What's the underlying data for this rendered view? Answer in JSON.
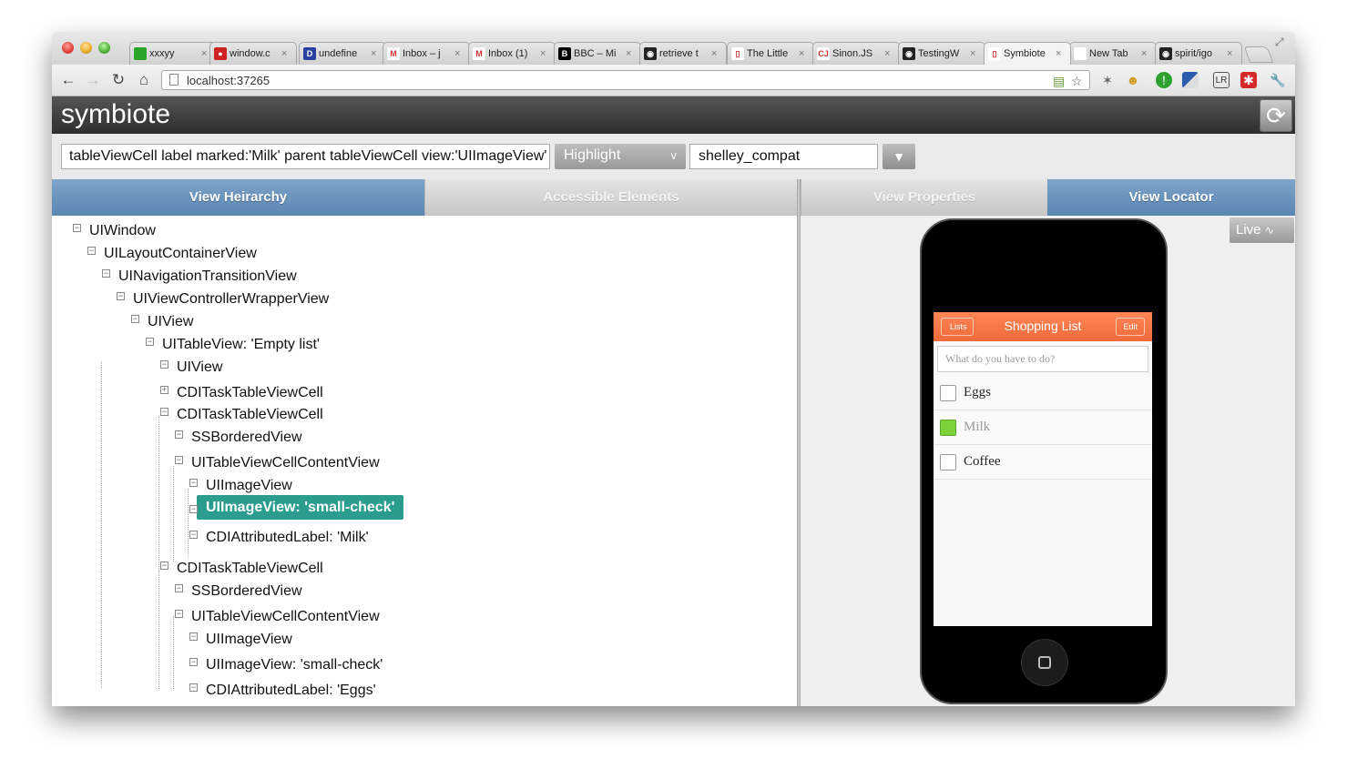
{
  "browser": {
    "tabs": [
      {
        "label": "xxxyy",
        "fav_color": "#2aa52a",
        "fav_glyph": ""
      },
      {
        "label": "window.c",
        "fav_color": "#cc2222",
        "fav_glyph": "●"
      },
      {
        "label": "undefine",
        "fav_color": "#2a3fa0",
        "fav_glyph": "D"
      },
      {
        "label": "Inbox – j",
        "fav_color": "#ffffff",
        "fav_glyph": "M"
      },
      {
        "label": "Inbox (1)",
        "fav_color": "#ffffff",
        "fav_glyph": "M"
      },
      {
        "label": "BBC – Mi",
        "fav_color": "#000000",
        "fav_glyph": "B"
      },
      {
        "label": "retrieve t",
        "fav_color": "#222222",
        "fav_glyph": "◉"
      },
      {
        "label": "The Little",
        "fav_color": "#ffffff",
        "fav_glyph": "▯"
      },
      {
        "label": "Sinon.JS",
        "fav_color": "#ffffff",
        "fav_glyph": "CJ"
      },
      {
        "label": "TestingW",
        "fav_color": "#222222",
        "fav_glyph": "◉"
      },
      {
        "label": "Symbiote",
        "fav_color": "#ffffff",
        "fav_glyph": "▯"
      },
      {
        "label": "New Tab",
        "fav_color": "#ffffff",
        "fav_glyph": ""
      },
      {
        "label": "spirit/igo",
        "fav_color": "#222222",
        "fav_glyph": "◉"
      }
    ],
    "active_tab_index": 10,
    "url": "localhost:37265"
  },
  "app": {
    "title": "symbiote",
    "query": "tableViewCell label marked:'Milk' parent tableViewCell view:'UIImageView'",
    "highlight_label": "Highlight",
    "highlight_chevron": "v",
    "mode_value": "shelley_compat",
    "dropdown_glyph": "▼",
    "left_tabs": [
      "View Heirarchy",
      "Accessible Elements"
    ],
    "right_tabs": [
      "View Properties",
      "View Locator"
    ],
    "live_label": "Live"
  },
  "tree": [
    {
      "label": "UIWindow",
      "depth": 0,
      "toggle": "−"
    },
    {
      "label": "UILayoutContainerView",
      "depth": 1,
      "toggle": "−"
    },
    {
      "label": "UINavigationTransitionView",
      "depth": 2,
      "toggle": "−"
    },
    {
      "label": "UIViewControllerWrapperView",
      "depth": 3,
      "toggle": "−"
    },
    {
      "label": "UIView",
      "depth": 4,
      "toggle": "−"
    },
    {
      "label": "UITableView: 'Empty list'",
      "depth": 5,
      "toggle": "−"
    },
    {
      "label": "UIView",
      "depth": 6,
      "toggle": "−"
    },
    {
      "label": "CDITaskTableViewCell",
      "depth": 6,
      "toggle": "+"
    },
    {
      "label": "CDITaskTableViewCell",
      "depth": 6,
      "toggle": "−"
    },
    {
      "label": "SSBorderedView",
      "depth": 7,
      "toggle": "−"
    },
    {
      "label": "UITableViewCellContentView",
      "depth": 7,
      "toggle": "−"
    },
    {
      "label": "UIImageView",
      "depth": 8,
      "toggle": "−"
    },
    {
      "label": "UIImageView: 'small-check'",
      "depth": 8,
      "toggle": "−",
      "selected": true
    },
    {
      "label": "CDIAttributedLabel: 'Milk'",
      "depth": 8,
      "toggle": "−"
    },
    {
      "label": "CDITaskTableViewCell",
      "depth": 6,
      "toggle": "−"
    },
    {
      "label": "SSBorderedView",
      "depth": 7,
      "toggle": "−"
    },
    {
      "label": "UITableViewCellContentView",
      "depth": 7,
      "toggle": "−"
    },
    {
      "label": "UIImageView",
      "depth": 8,
      "toggle": "−"
    },
    {
      "label": "UIImageView: 'small-check'",
      "depth": 8,
      "toggle": "−"
    },
    {
      "label": "CDIAttributedLabel: 'Eggs'",
      "depth": 8,
      "toggle": "−"
    }
  ],
  "device": {
    "nav_back": "Lists",
    "nav_title": "Shopping List",
    "nav_edit": "Edit",
    "input_placeholder": "What do you have to do?",
    "items": [
      {
        "label": "Eggs",
        "checked": false
      },
      {
        "label": "Milk",
        "checked": true
      },
      {
        "label": "Coffee",
        "checked": false
      }
    ],
    "accent_color": "#f37446"
  }
}
